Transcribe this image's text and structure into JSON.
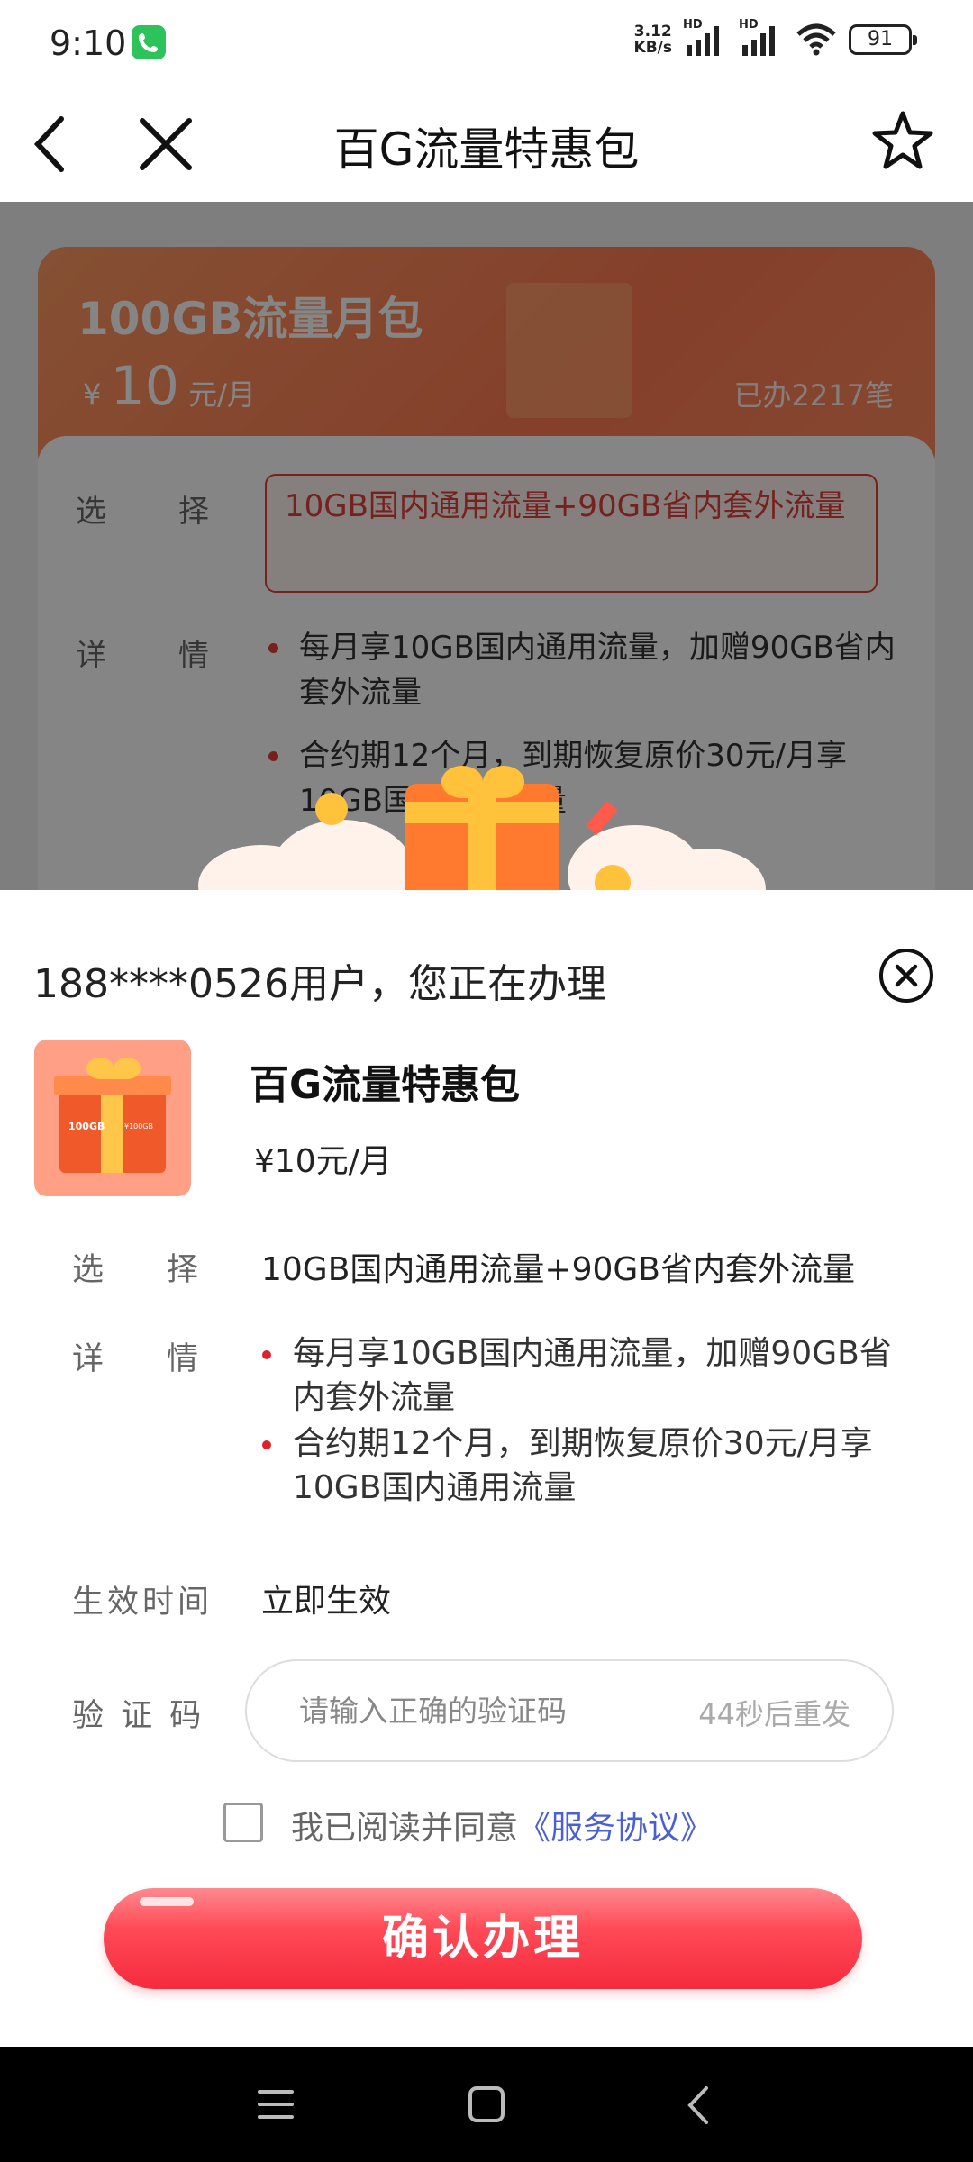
{
  "status_bar": {
    "time": "9:10",
    "net_speed_value": "3.12",
    "net_speed_unit": "KB/s",
    "signal_label_1": "HD",
    "signal_label_2": "HD",
    "battery": "91"
  },
  "nav": {
    "title": "百G流量特惠包",
    "back_icon": "back-arrow",
    "close_icon": "close-x",
    "favorite_icon": "star-outline"
  },
  "background_page": {
    "package_name": "100GB流量月包",
    "price_symbol": "¥",
    "price_value": "10",
    "price_unit": "元/月",
    "sold_count": "已办2217笔",
    "select_label": "选　　择",
    "select_option": "10GB国内通用流量+90GB省内套外流量",
    "detail_label": "详　　情",
    "detail_items": [
      "每月享10GB国内通用流量，加赠90GB省内套外流量",
      "合约期12个月，到期恢复原价30元/月享10GB国内通用流量"
    ]
  },
  "sheet": {
    "title": "188****0526用户，您正在办理",
    "product_image_text_1": "100GB",
    "product_image_text_2": "¥100GB",
    "product_name": "百G流量特惠包",
    "product_price": "¥10元/月",
    "select_label": "选　　择",
    "select_value": "10GB国内通用流量+90GB省内套外流量",
    "detail_label": "详　　情",
    "detail_items": [
      "每月享10GB国内通用流量，加赠90GB省内套外流量",
      "合约期12个月，到期恢复原价30元/月享10GB国内通用流量"
    ],
    "effective_label": "生效时间",
    "effective_value": "立即生效",
    "code_label": "验 证 码",
    "code_placeholder": "请输入正确的验证码",
    "code_value": "",
    "resend_text": "44秒后重发",
    "agree_text": "我已阅读并同意",
    "agree_link": "《服务协议》",
    "agree_checked": false,
    "confirm_label": "确认办理"
  },
  "colors": {
    "accent_red": "#f52b3d",
    "link_blue": "#4a5fd6",
    "banner_orange": "#ff7a52"
  }
}
